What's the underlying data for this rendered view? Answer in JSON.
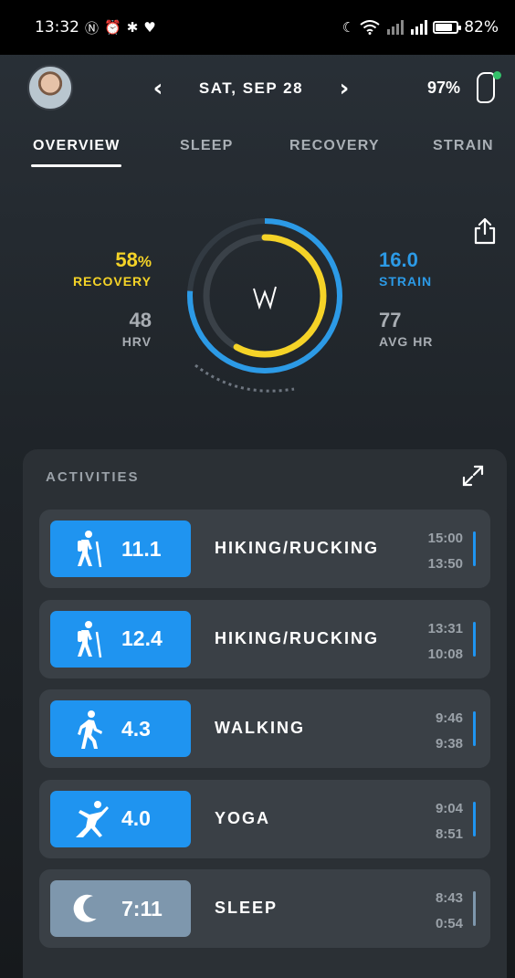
{
  "status_bar": {
    "time": "13:32",
    "battery_percent": "82%",
    "battery_level": 0.82
  },
  "header": {
    "date": "SAT, SEP 28",
    "prev_icon": "chevron-left-icon",
    "next_icon": "chevron-right-icon",
    "device_battery": "97%"
  },
  "tabs": [
    {
      "label": "OVERVIEW",
      "active": true
    },
    {
      "label": "SLEEP",
      "active": false
    },
    {
      "label": "RECOVERY",
      "active": false
    },
    {
      "label": "STRAIN",
      "active": false
    }
  ],
  "overview": {
    "recovery_value": "58",
    "recovery_unit": "%",
    "recovery_label": "RECOVERY",
    "hrv_value": "48",
    "hrv_label": "HRV",
    "strain_value": "16.0",
    "strain_label": "STRAIN",
    "avg_hr_value": "77",
    "avg_hr_label": "AVG HR",
    "recovery_fraction": 0.58,
    "strain_fraction": 0.76,
    "colors": {
      "recovery": "#f5d327",
      "strain": "#2c9ae6",
      "muted": "#a8adb3"
    }
  },
  "activities": {
    "title": "ACTIVITIES",
    "items": [
      {
        "icon": "hiking-icon",
        "value": "11.1",
        "name": "HIKING/RUCKING",
        "end": "15:00",
        "start": "13:50",
        "kind": "strain"
      },
      {
        "icon": "hiking-icon",
        "value": "12.4",
        "name": "HIKING/RUCKING",
        "end": "13:31",
        "start": "10:08",
        "kind": "strain"
      },
      {
        "icon": "walking-icon",
        "value": "4.3",
        "name": "WALKING",
        "end": "9:46",
        "start": "9:38",
        "kind": "strain"
      },
      {
        "icon": "yoga-icon",
        "value": "4.0",
        "name": "YOGA",
        "end": "9:04",
        "start": "8:51",
        "kind": "strain"
      },
      {
        "icon": "moon-icon",
        "value": "7:11",
        "name": "SLEEP",
        "end": "8:43",
        "start": "0:54",
        "kind": "sleep"
      }
    ]
  }
}
